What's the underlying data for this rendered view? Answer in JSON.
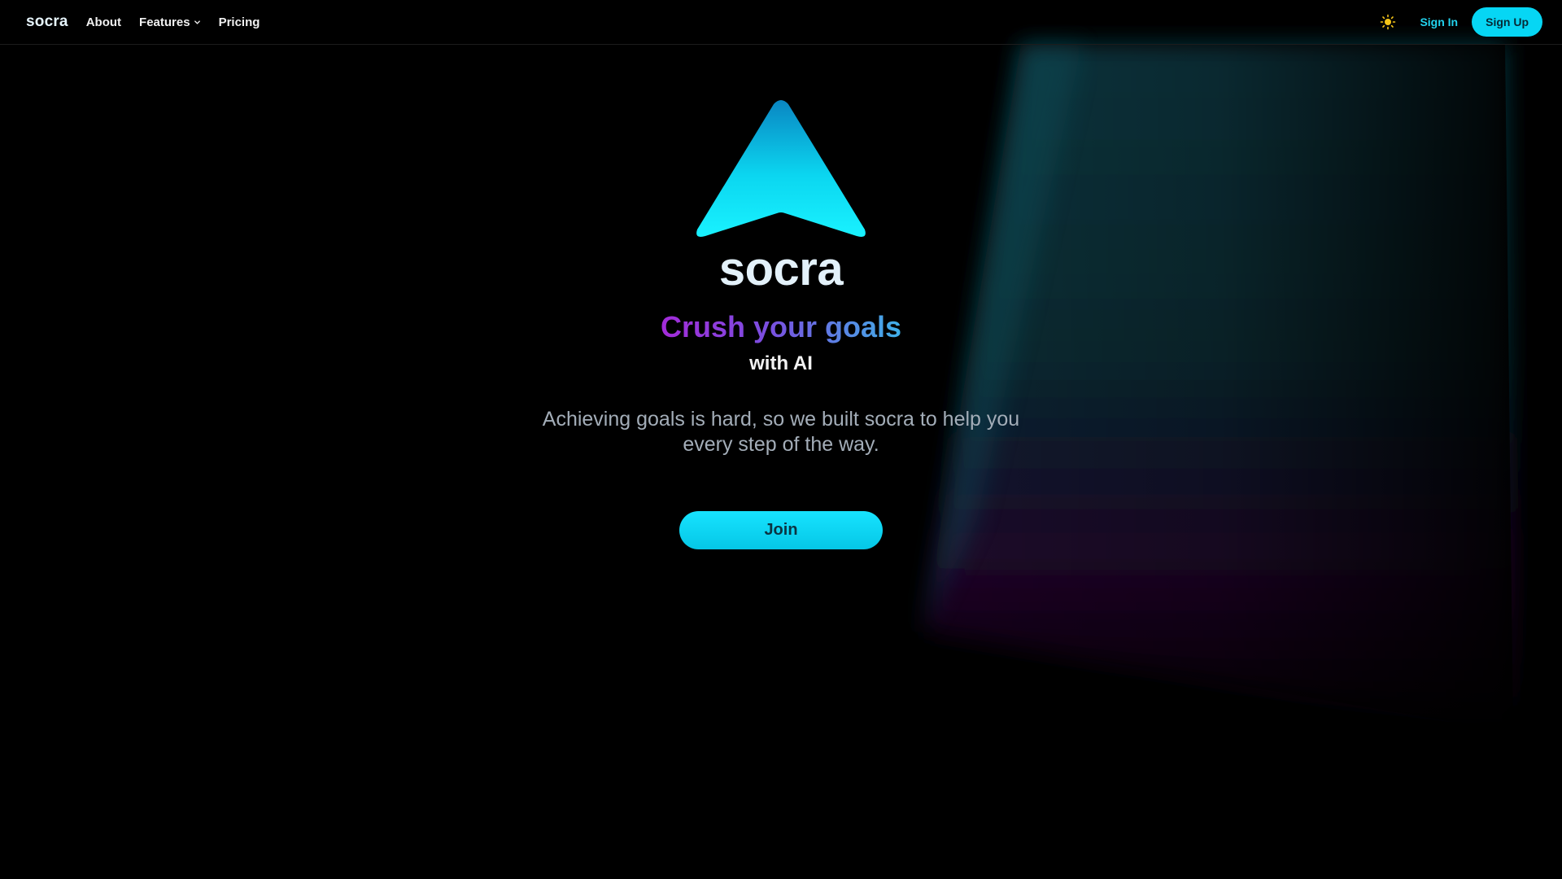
{
  "nav": {
    "brand": "socra",
    "links": [
      {
        "label": "About"
      },
      {
        "label": "Features",
        "has_dropdown": true
      },
      {
        "label": "Pricing"
      }
    ],
    "theme_icon": "sun-icon",
    "sign_in": "Sign In",
    "sign_up": "Sign Up"
  },
  "hero": {
    "logo_icon": "socra-arrow-logo",
    "title": "socra",
    "tagline": "Crush your goals",
    "sub_tagline": "with AI",
    "description": "Achieving goals is hard, so we built socra to help you every step of the way.",
    "cta": "Join"
  },
  "colors": {
    "background": "#000000",
    "accent": "#06d6f4",
    "tagline_gradient": [
      "#a32bd9",
      "#3fb0e8"
    ],
    "description_text": "#a3adb8"
  }
}
